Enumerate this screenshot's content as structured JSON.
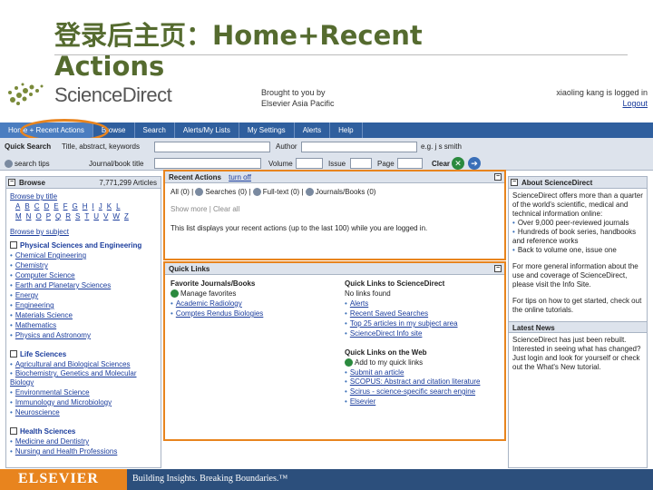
{
  "slide": {
    "title": "登录后主页：Home+Recent Actions"
  },
  "header": {
    "logo": "ScienceDirect",
    "brought_line1": "Brought to you by",
    "brought_line2": "Elsevier Asia Pacific",
    "user_line": "xiaoling kang is logged in",
    "logout": "Logout"
  },
  "nav": {
    "items": [
      "Home + Recent Actions",
      "Browse",
      "Search",
      "Alerts/My Lists",
      "My Settings",
      "Alerts",
      "Help"
    ]
  },
  "quick_search": {
    "label": "Quick Search",
    "title_label": "Title, abstract, keywords",
    "author_label": "Author",
    "tips": "search tips",
    "journal_label": "Journal/book title",
    "volume_label": "Volume",
    "issue_label": "Issue",
    "page_label": "Page",
    "clear": "Clear",
    "within": "e.g. j s smith"
  },
  "browse": {
    "title": "Browse",
    "count": "7,771,299 Articles",
    "by_title": "Browse by title",
    "letters1": [
      "A",
      "B",
      "C",
      "D",
      "E",
      "F",
      "G",
      "H",
      "I",
      "J",
      "K",
      "L"
    ],
    "letters2": [
      "M",
      "N",
      "O",
      "P",
      "Q",
      "R",
      "S",
      "T",
      "U",
      "V",
      "W",
      "Z"
    ],
    "by_subject": "Browse by subject",
    "cats": [
      {
        "name": "Physical Sciences and Engineering",
        "items": [
          "Chemical Engineering",
          "Chemistry",
          "Computer Science",
          "Earth and Planetary Sciences",
          "Energy",
          "Engineering",
          "Materials Science",
          "Mathematics",
          "Physics and Astronomy"
        ]
      },
      {
        "name": "Life Sciences",
        "items": [
          "Agricultural and Biological Sciences",
          "Biochemistry, Genetics and Molecular Biology",
          "Environmental Science",
          "Immunology and Microbiology",
          "Neuroscience"
        ]
      },
      {
        "name": "Health Sciences",
        "items": [
          "Medicine and Dentistry",
          "Nursing and Health Professions"
        ]
      }
    ]
  },
  "recent": {
    "title": "Recent Actions",
    "turn_off": "turn off",
    "tabs": [
      "All (0)",
      "Searches (0)",
      "Full-text (0)",
      "Journals/Books (0)"
    ],
    "show_more": "Show more",
    "clear": "Clear all",
    "note": "This list displays your recent actions (up to the last 100) while you are logged in."
  },
  "quick_links": {
    "title": "Quick Links",
    "fav_title": "Favorite Journals/Books",
    "fav_manage": "Manage favorites",
    "fav_items": [
      "Academic Radiology",
      "Comptes Rendus Biologies"
    ],
    "sd_title": "Quick Links to ScienceDirect",
    "sd_sub": "No links found",
    "sd_items": [
      "Alerts",
      "Recent Saved Searches",
      "Top 25 articles in my subject area",
      "ScienceDirect Info site"
    ],
    "web_title": "Quick Links on the Web",
    "web_add": "Add to my quick links",
    "web_items": [
      "Submit an article",
      "SCOPUS: Abstract and citation literature",
      "Scirus - science-specific search engine",
      "Elsevier"
    ]
  },
  "about": {
    "title": "About ScienceDirect",
    "text": "ScienceDirect offers more than a quarter of the world's scientific, medical and technical information online:",
    "items": [
      "Over 9,000 peer-reviewed journals",
      "Hundreds of book series, handbooks and reference works",
      "Back to volume one, issue one"
    ],
    "more": "For more general information about the use and coverage of ScienceDirect, please visit the Info Site.",
    "tips": "For tips on how to get started, check out the online tutorials."
  },
  "news": {
    "title": "Latest News",
    "text": "ScienceDirect has just been rebuilt. Interested in seeing what has changed? Just login and look for yourself or check out the What's New tutorial."
  },
  "footer": {
    "brand": "ELSEVIER",
    "tagline": "Building Insights. Breaking Boundaries.™"
  },
  "colors": {
    "accent": "#e8841e",
    "nav": "#2f5f9e",
    "link": "#1a3c9c",
    "title": "#556b2f"
  }
}
